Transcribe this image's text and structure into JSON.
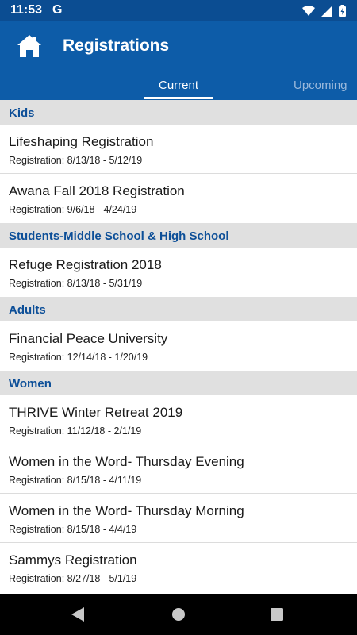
{
  "status_bar": {
    "time": "11:53",
    "google_icon": "G",
    "icons": [
      "wifi-icon",
      "signal-icon",
      "battery-icon"
    ]
  },
  "app_bar": {
    "title": "Registrations",
    "home_icon": "home-icon"
  },
  "tabs": [
    {
      "label": "Current",
      "selected": true
    },
    {
      "label": "Upcoming",
      "selected": false
    }
  ],
  "sections": [
    {
      "header": "Kids",
      "items": [
        {
          "title": "Lifeshaping Registration",
          "subtitle": "Registration: 8/13/18 - 5/12/19"
        },
        {
          "title": "Awana Fall 2018 Registration",
          "subtitle": "Registration: 9/6/18 - 4/24/19"
        }
      ]
    },
    {
      "header": "Students-Middle School & High School",
      "items": [
        {
          "title": "Refuge Registration 2018",
          "subtitle": "Registration: 8/13/18 - 5/31/19"
        }
      ]
    },
    {
      "header": "Adults",
      "items": [
        {
          "title": "Financial Peace University",
          "subtitle": "Registration: 12/14/18 - 1/20/19"
        }
      ]
    },
    {
      "header": "Women",
      "items": [
        {
          "title": "THRIVE Winter Retreat 2019",
          "subtitle": "Registration: 11/12/18 - 2/1/19"
        },
        {
          "title": "Women in the Word- Thursday Evening",
          "subtitle": "Registration: 8/15/18 - 4/11/19"
        },
        {
          "title": "Women in the Word- Thursday Morning",
          "subtitle": "Registration: 8/15/18 - 4/4/19"
        },
        {
          "title": "Sammys Registration",
          "subtitle": "Registration: 8/27/18 - 5/1/19"
        }
      ]
    }
  ],
  "nav_bar": {
    "icons": [
      "back-icon",
      "home-nav-icon",
      "recents-icon"
    ]
  },
  "colors": {
    "app_bar": "#0d5ca8",
    "status_bar": "#0b4d92",
    "section_header_text": "#0d4f98",
    "section_header_bg": "#e0e0e0"
  }
}
